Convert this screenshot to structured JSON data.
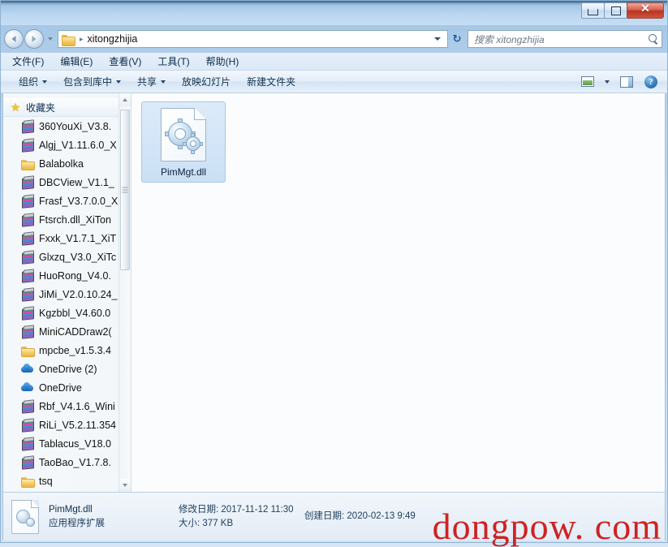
{
  "window": {
    "buttons": {
      "minimize": "minimize-button",
      "maximize": "maximize-button",
      "close_label": "✕"
    }
  },
  "address_bar": {
    "path_segment": "xitongzhijia",
    "separator": "▸",
    "refresh_label": "↻"
  },
  "search": {
    "placeholder": "搜索 xitongzhijia"
  },
  "menubar": {
    "items": [
      {
        "label": "文件(F)"
      },
      {
        "label": "编辑(E)"
      },
      {
        "label": "查看(V)"
      },
      {
        "label": "工具(T)"
      },
      {
        "label": "帮助(H)"
      }
    ]
  },
  "toolbar": {
    "items": [
      {
        "label": "组织",
        "has_caret": true
      },
      {
        "label": "包含到库中",
        "has_caret": true
      },
      {
        "label": "共享",
        "has_caret": true
      },
      {
        "label": "放映幻灯片",
        "has_caret": false
      },
      {
        "label": "新建文件夹",
        "has_caret": false
      }
    ],
    "help_label": "?"
  },
  "sidebar": {
    "header": "收藏夹",
    "items": [
      {
        "label": "360YouXi_V3.8.",
        "icon": "winrar-archive-icon"
      },
      {
        "label": "Algj_V1.11.6.0_X",
        "icon": "winrar-archive-icon"
      },
      {
        "label": "Balabolka",
        "icon": "folder-icon"
      },
      {
        "label": "DBCView_V1.1_",
        "icon": "winrar-archive-icon"
      },
      {
        "label": "Frasf_V3.7.0.0_X",
        "icon": "winrar-archive-icon"
      },
      {
        "label": "Ftsrch.dll_XiTon",
        "icon": "winrar-archive-icon"
      },
      {
        "label": "Fxxk_V1.7.1_XiT",
        "icon": "winrar-archive-icon"
      },
      {
        "label": "Glxzq_V3.0_XiTc",
        "icon": "winrar-archive-icon"
      },
      {
        "label": "HuoRong_V4.0.",
        "icon": "winrar-archive-icon"
      },
      {
        "label": "JiMi_V2.0.10.24_",
        "icon": "winrar-archive-icon"
      },
      {
        "label": "Kgzbbl_V4.60.0",
        "icon": "winrar-archive-icon"
      },
      {
        "label": "MiniCADDraw2(",
        "icon": "winrar-archive-icon"
      },
      {
        "label": "mpcbe_v1.5.3.4",
        "icon": "folder-icon"
      },
      {
        "label": "OneDrive (2)",
        "icon": "onedrive-icon"
      },
      {
        "label": "OneDrive",
        "icon": "onedrive-icon"
      },
      {
        "label": "Rbf_V4.1.6_Wini",
        "icon": "winrar-archive-icon"
      },
      {
        "label": "RiLi_V5.2.11.354",
        "icon": "winrar-archive-icon"
      },
      {
        "label": "Tablacus_V18.0",
        "icon": "winrar-archive-icon"
      },
      {
        "label": "TaoBao_V1.7.8.",
        "icon": "winrar-archive-icon"
      },
      {
        "label": "tsq",
        "icon": "folder-icon"
      }
    ]
  },
  "content": {
    "files": [
      {
        "name": "PimMgt.dll",
        "icon": "dll-file-icon",
        "selected": true
      }
    ]
  },
  "status_bar": {
    "file_name": "PimMgt.dll",
    "file_type": "应用程序扩展",
    "modified_label": "修改日期:",
    "modified_value": "2017-11-12 11:30",
    "size_label": "大小:",
    "size_value": "377 KB",
    "created_label": "创建日期:",
    "created_value": "2020-02-13 9:49"
  },
  "watermark": {
    "text": "dongpow. com",
    "color": "#cf2222"
  }
}
